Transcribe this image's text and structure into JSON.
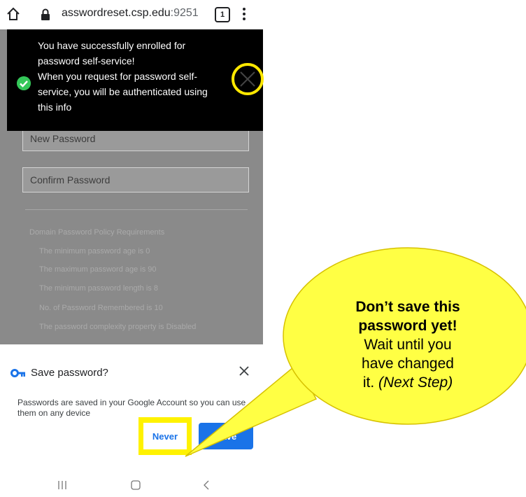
{
  "browser": {
    "url_domain": "asswordreset.csp.edu",
    "url_port": ":9251",
    "tab_count": "1"
  },
  "form": {
    "new_password_placeholder": "New Password",
    "confirm_password_placeholder": "Confirm Password"
  },
  "policy": {
    "title": "Domain Password Policy Requirements",
    "items": [
      "The minimum password age is 0",
      "The maximum password age is 90",
      "The minimum password length is 8",
      "No. of Password Remembered is 10",
      "The password complexity property is Disabled"
    ]
  },
  "toast": {
    "lines": [
      "You have successfully enrolled for",
      "password self-service!",
      "When you request for password self-",
      "service, you will be authenticated using",
      "this info"
    ]
  },
  "save_dialog": {
    "title": "Save password?",
    "description": "Passwords are saved in your Google Account so you can use them on any device",
    "never_label": "Never",
    "save_label": "Save"
  },
  "callout": {
    "bold_line1": "Don’t save this",
    "bold_line2": "password yet!",
    "line3": "Wait until you",
    "line4": "have changed",
    "line5_plain": "it. ",
    "line5_italic": "(Next Step)"
  },
  "colors": {
    "highlight_yellow": "#fff200",
    "callout_yellow": "#ffff44",
    "save_blue": "#1a73e8",
    "success_green": "#34c759"
  }
}
